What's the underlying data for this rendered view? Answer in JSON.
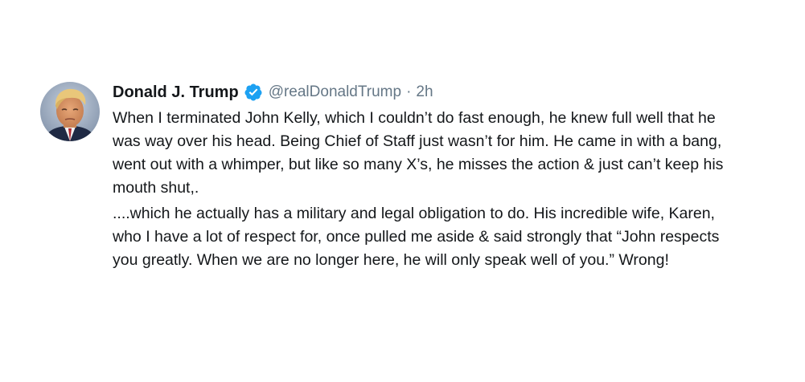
{
  "tweet": {
    "author_name": "Donald J. Trump",
    "handle": "@realDonaldTrump",
    "separator": "·",
    "time": "2h",
    "verified_icon": "verified-badge-icon",
    "paragraphs": [
      "When I terminated John Kelly, which I couldn’t do fast enough, he knew full well that he was way over his head. Being Chief of Staff just wasn’t for him. He came in with a bang, went out with a whimper, but like so many X’s, he misses the action & just can’t keep his mouth shut,.",
      "....which he actually has a military and legal obligation to do. His incredible wife, Karen, who I have a lot of respect for, once pulled me aside & said strongly that “John respects you greatly. When we are no longer here, he will only speak well of you.” Wrong!"
    ]
  },
  "colors": {
    "text": "#14171a",
    "secondary": "#657786",
    "verified_blue": "#1da1f2"
  }
}
